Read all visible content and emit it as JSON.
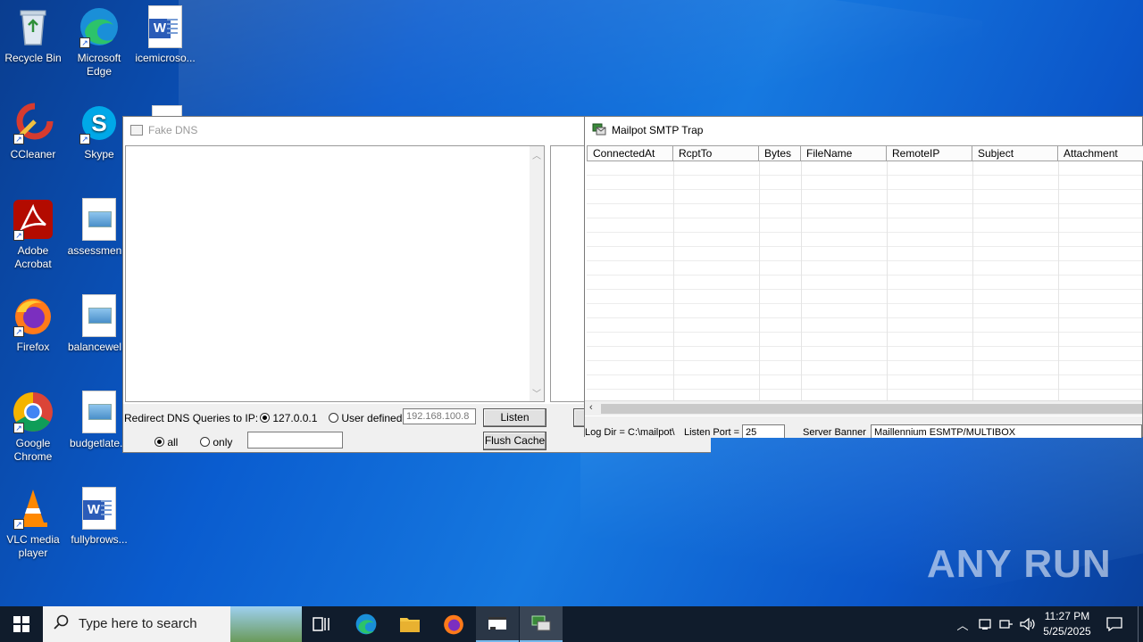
{
  "desktop": {
    "icons": [
      {
        "label": "Recycle Bin"
      },
      {
        "label": "Microsoft Edge"
      },
      {
        "label": "icemicroso..."
      },
      {
        "label": "CCleaner"
      },
      {
        "label": "Skype"
      },
      {
        "label": "Adobe Acrobat"
      },
      {
        "label": "assessmen..."
      },
      {
        "label": "Firefox"
      },
      {
        "label": "balancewel..."
      },
      {
        "label": "Google Chrome"
      },
      {
        "label": "budgetlate..."
      },
      {
        "label": "VLC media player"
      },
      {
        "label": "fullybrows..."
      }
    ],
    "watermark": "ANY RUN"
  },
  "fake_dns": {
    "title": "Fake DNS",
    "redirect_label": "Redirect DNS Queries to IP:",
    "opt_localhost": "127.0.0.1",
    "opt_user": "User defined",
    "user_ip": "192.168.100.8",
    "listen_btn": "Listen",
    "flush_btn": "Flush Cache",
    "opt_all": "all",
    "opt_only": "only",
    "only_value": ""
  },
  "mailpot": {
    "title": "Mailpot SMTP Trap",
    "columns": [
      "ConnectedAt",
      "RcptTo",
      "Bytes",
      "FileName",
      "RemoteIP",
      "Subject",
      "Attachment"
    ],
    "log_dir_label": "Log Dir = C:\\mailpot\\",
    "listen_port_label": "Listen Port =",
    "listen_port": "25",
    "server_banner_label": "Server Banner",
    "server_banner": "Maillennium ESMTP/MULTIBOX"
  },
  "taskbar": {
    "search_placeholder": "Type here to search",
    "time": "11:27 PM",
    "date": "5/25/2025"
  },
  "colors": {
    "desktop_accent": "#0a5ccf",
    "taskbar": "#101c2c"
  }
}
